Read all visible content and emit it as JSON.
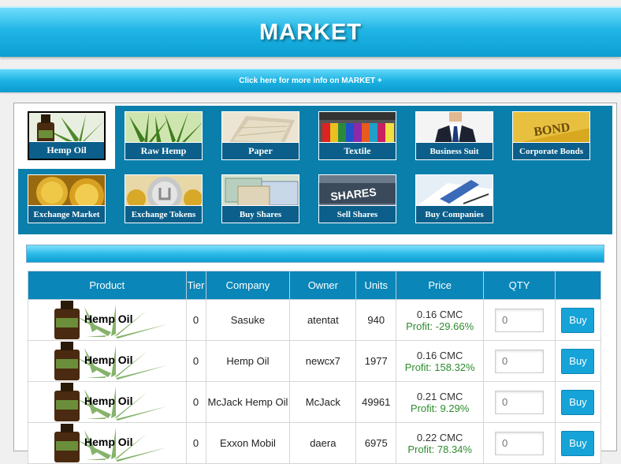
{
  "header": {
    "title": "MARKET"
  },
  "infobar": {
    "link_text": "Click here for more info on MARKET +"
  },
  "categories": [
    {
      "label": "Hemp Oil",
      "icon": "hemp-oil-icon",
      "active": true
    },
    {
      "label": "Raw Hemp",
      "icon": "raw-hemp-icon",
      "active": false
    },
    {
      "label": "Paper",
      "icon": "paper-icon",
      "active": false
    },
    {
      "label": "Textile",
      "icon": "textile-icon",
      "active": false
    },
    {
      "label": "Business Suit",
      "icon": "business-suit-icon",
      "active": false
    },
    {
      "label": "Corporate Bonds",
      "icon": "corporate-bonds-icon",
      "active": false
    },
    {
      "label": "Exchange Market",
      "icon": "exchange-market-icon",
      "active": false
    },
    {
      "label": "Exchange Tokens",
      "icon": "exchange-tokens-icon",
      "active": false
    },
    {
      "label": "Buy Shares",
      "icon": "buy-shares-icon",
      "active": false
    },
    {
      "label": "Sell Shares",
      "icon": "sell-shares-icon",
      "active": false
    },
    {
      "label": "Buy Companies",
      "icon": "buy-companies-icon",
      "active": false
    }
  ],
  "bond_text": "BOND",
  "shares_text": "SHARES",
  "table": {
    "headers": {
      "product": "Product",
      "tier": "Tier",
      "company": "Company",
      "owner": "Owner",
      "units": "Units",
      "price": "Price",
      "qty": "QTY"
    },
    "buy_label": "Buy",
    "qty_placeholder": "0",
    "rows": [
      {
        "product": "Hemp Oil",
        "tier": "0",
        "company": "Sasuke",
        "owner": "atentat",
        "units": "940",
        "price": "0.16 CMC",
        "profit": "Profit: -29.66%"
      },
      {
        "product": "Hemp Oil",
        "tier": "0",
        "company": "Hemp Oil",
        "owner": "newcx7",
        "units": "1977",
        "price": "0.16 CMC",
        "profit": "Profit: 158.32%"
      },
      {
        "product": "Hemp Oil",
        "tier": "0",
        "company": "McJack Hemp Oil",
        "owner": "McJack",
        "units": "49961",
        "price": "0.21 CMC",
        "profit": "Profit: 9.29%"
      },
      {
        "product": "Hemp Oil",
        "tier": "0",
        "company": "Exxon Mobil",
        "owner": "daera",
        "units": "6975",
        "price": "0.22 CMC",
        "profit": "Profit: 78.34%"
      }
    ]
  },
  "colors": {
    "accent": "#0b86b8",
    "profit": "#2e8b2e",
    "header": "#21b6e6"
  }
}
